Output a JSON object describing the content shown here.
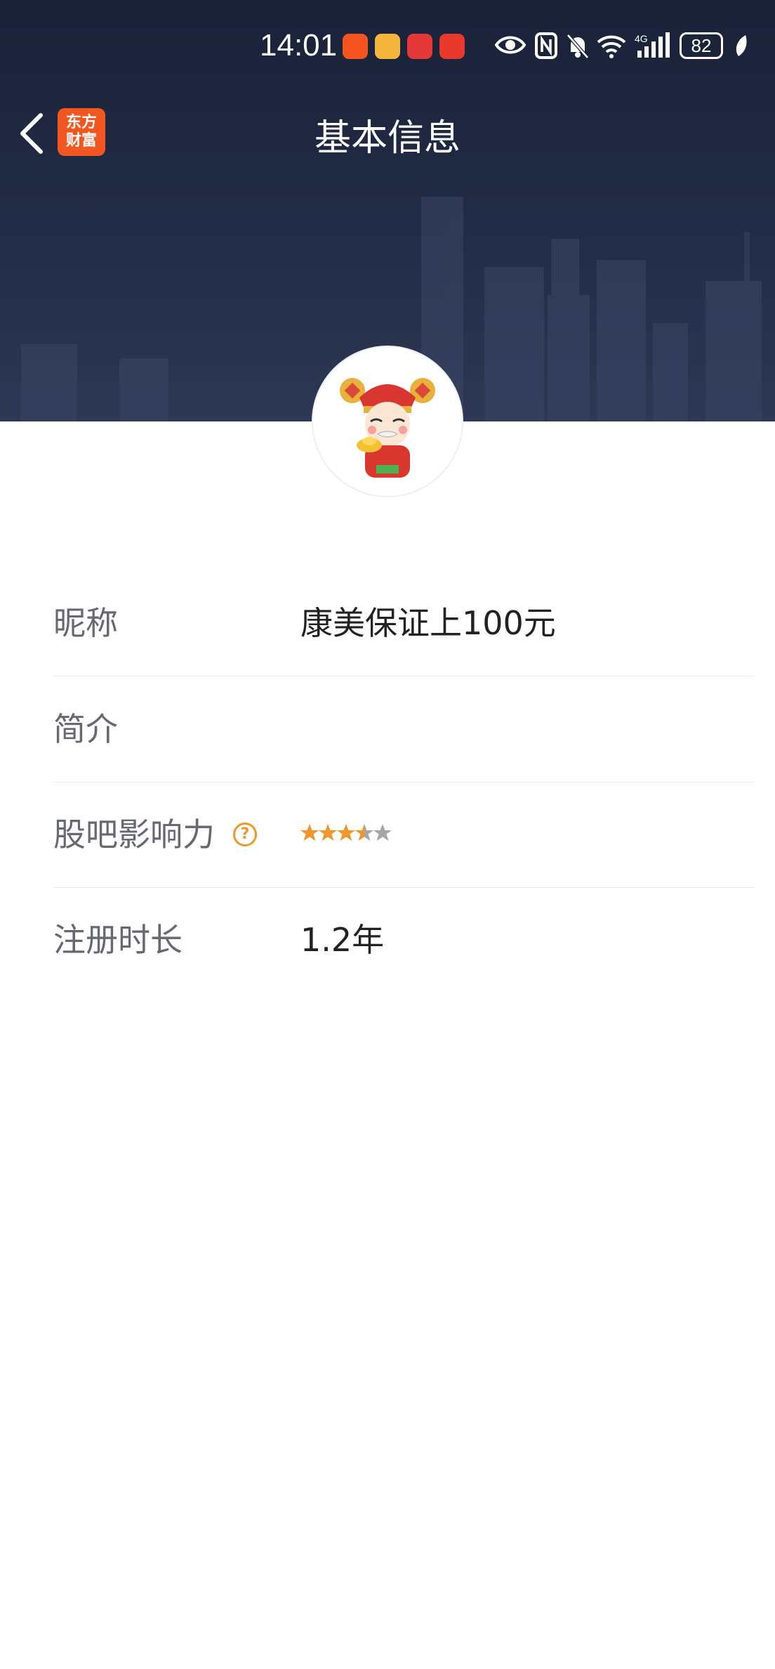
{
  "status_bar": {
    "time": "14:01",
    "battery": "82"
  },
  "nav": {
    "title": "基本信息",
    "logo_line1": "东方",
    "logo_line2": "财富"
  },
  "profile": {
    "rows": [
      {
        "label": "昵称",
        "value": "康美保证上100元"
      },
      {
        "label": "简介",
        "value": ""
      },
      {
        "label": "股吧影响力",
        "value": "",
        "help_icon": "?",
        "rating": 3.5,
        "rating_max": 5
      },
      {
        "label": "注册时长",
        "value": "1.2年"
      }
    ]
  },
  "colors": {
    "header_bg": "#1f2740",
    "star_on": "#f0962c",
    "star_off": "#a6a6a6",
    "logo_bg": "#f4561f"
  }
}
